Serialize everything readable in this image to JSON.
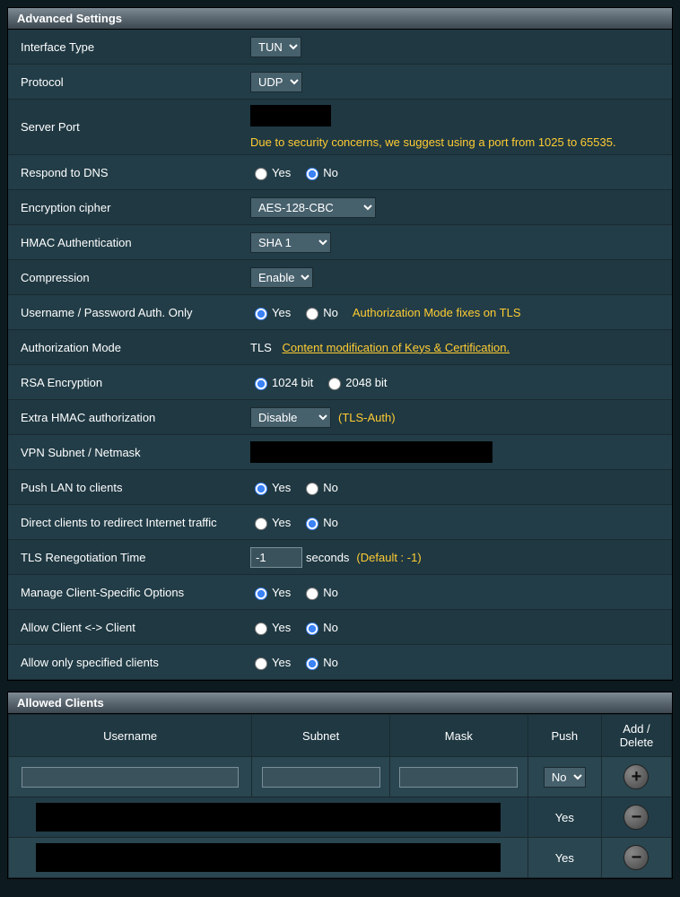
{
  "sections": {
    "advanced": "Advanced Settings",
    "allowed": "Allowed Clients"
  },
  "rows": {
    "interface_type": {
      "label": "Interface Type",
      "options": [
        "TUN"
      ]
    },
    "protocol": {
      "label": "Protocol",
      "options": [
        "UDP"
      ]
    },
    "server_port": {
      "label": "Server Port",
      "note": "Due to security concerns, we suggest using a port from 1025 to 65535."
    },
    "respond_dns": {
      "label": "Respond to DNS",
      "yes": "Yes",
      "no": "No",
      "value": "no"
    },
    "cipher": {
      "label": "Encryption cipher",
      "options": [
        "AES-128-CBC"
      ]
    },
    "hmac": {
      "label": "HMAC Authentication",
      "options": [
        "SHA 1"
      ]
    },
    "compression": {
      "label": "Compression",
      "options": [
        "Enable"
      ]
    },
    "upw": {
      "label": "Username / Password Auth. Only",
      "yes": "Yes",
      "no": "No",
      "value": "yes",
      "note": "Authorization Mode fixes on TLS"
    },
    "auth_mode": {
      "label": "Authorization Mode",
      "prefix": "TLS",
      "link": "Content modification of Keys & Certification."
    },
    "rsa": {
      "label": "RSA Encryption",
      "opt1": "1024 bit",
      "opt2": "2048 bit",
      "value": "1024"
    },
    "extra_hmac": {
      "label": "Extra HMAC authorization",
      "options": [
        "Disable"
      ],
      "note": "(TLS-Auth)"
    },
    "vpn_subnet": {
      "label": "VPN Subnet / Netmask"
    },
    "push_lan": {
      "label": "Push LAN to clients",
      "yes": "Yes",
      "no": "No",
      "value": "yes"
    },
    "redirect": {
      "label": "Direct clients to redirect Internet traffic",
      "yes": "Yes",
      "no": "No",
      "value": "no"
    },
    "tls_reneg": {
      "label": "TLS Renegotiation Time",
      "value": "-1",
      "unit": "seconds",
      "note": "(Default : -1)"
    },
    "manage_cs": {
      "label": "Manage Client-Specific Options",
      "yes": "Yes",
      "no": "No",
      "value": "yes"
    },
    "allow_cc": {
      "label": "Allow Client <-> Client",
      "yes": "Yes",
      "no": "No",
      "value": "no"
    },
    "allow_spec": {
      "label": "Allow only specified clients",
      "yes": "Yes",
      "no": "No",
      "value": "no"
    }
  },
  "table": {
    "headers": {
      "username": "Username",
      "subnet": "Subnet",
      "mask": "Mask",
      "push": "Push",
      "ad": "Add / Delete"
    },
    "push_options": [
      "No"
    ],
    "rows": [
      {
        "push": "Yes"
      },
      {
        "push": "Yes"
      }
    ]
  }
}
